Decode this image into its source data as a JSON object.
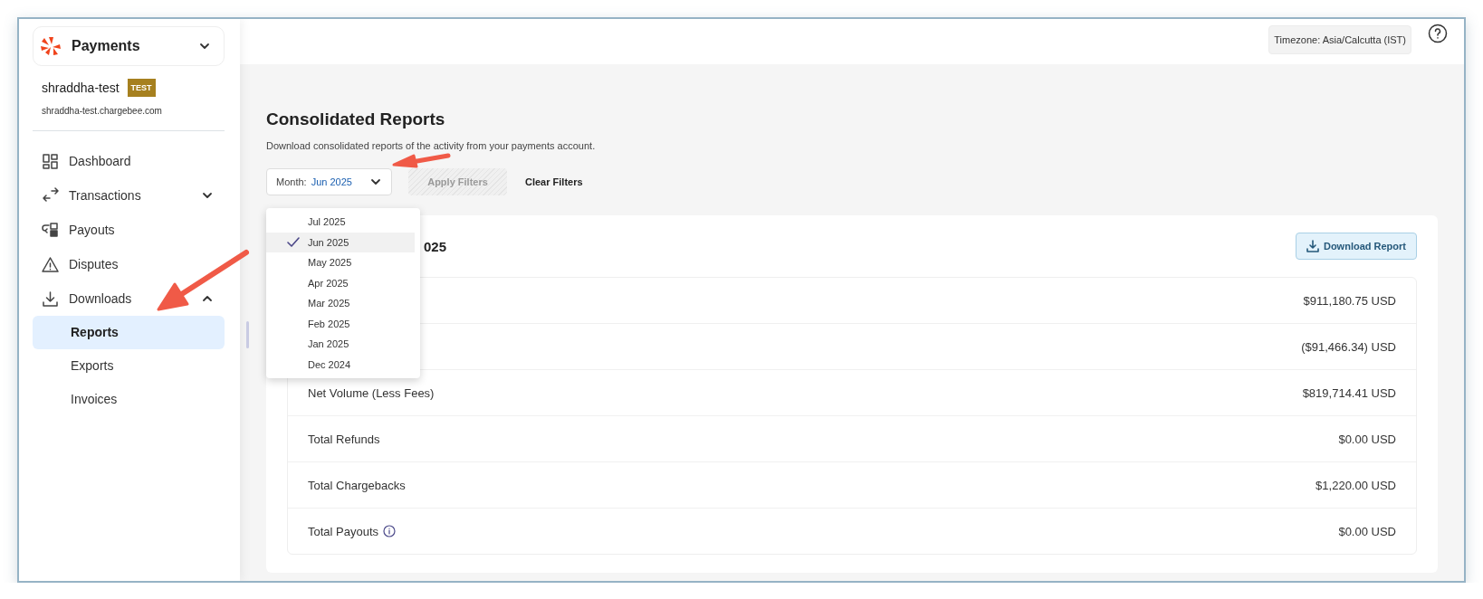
{
  "sidebar": {
    "product": "Payments",
    "account": {
      "name": "shraddha-test",
      "badge": "TEST",
      "url": "shraddha-test.chargebee.com"
    },
    "nav": [
      {
        "label": "Dashboard",
        "kind": "dashboard",
        "selected": false
      },
      {
        "label": "Transactions",
        "kind": "transfer",
        "selected": false,
        "expanded": false
      },
      {
        "label": "Payouts",
        "kind": "payout",
        "selected": false
      },
      {
        "label": "Disputes",
        "kind": "warning",
        "selected": false
      },
      {
        "label": "Downloads",
        "kind": "download",
        "selected": false,
        "expanded": true,
        "children": [
          {
            "label": "Reports",
            "selected": true
          },
          {
            "label": "Exports",
            "selected": false
          },
          {
            "label": "Invoices",
            "selected": false
          }
        ]
      }
    ]
  },
  "topbar": {
    "timezone": "Timezone: Asia/Calcutta (IST)"
  },
  "header": {
    "title": "Consolidated Reports",
    "subtitle": "Download consolidated reports of the activity from your payments account."
  },
  "filters": {
    "month_select": {
      "label": "Month:",
      "value": "Jun 2025",
      "open": true,
      "options": [
        {
          "label": "Jul 2025",
          "selected": false
        },
        {
          "label": "Jun 2025",
          "selected": true
        },
        {
          "label": "May 2025",
          "selected": false
        },
        {
          "label": "Apr 2025",
          "selected": false
        },
        {
          "label": "Mar 2025",
          "selected": false
        },
        {
          "label": "Feb 2025",
          "selected": false
        },
        {
          "label": "Jan 2025",
          "selected": false
        },
        {
          "label": "Dec 2024",
          "selected": false
        }
      ]
    },
    "apply_button": {
      "label": "Apply Filters",
      "disabled": true
    },
    "clear_button": {
      "label": "Clear Filters"
    }
  },
  "card": {
    "title": "025",
    "download_button": "Download Report",
    "rows": [
      {
        "value": "$911,180.75 USD"
      },
      {
        "value": "($91,466.34) USD"
      },
      {
        "label": "Net Volume (Less Fees)",
        "value": "$819,714.41 USD"
      },
      {
        "label": "Total Refunds",
        "value": "$0.00 USD"
      },
      {
        "label": "Total Chargebacks",
        "value": "$1,220.00 USD"
      },
      {
        "label": "Total Payouts",
        "value": "$0.00 USD",
        "info": true
      }
    ]
  }
}
